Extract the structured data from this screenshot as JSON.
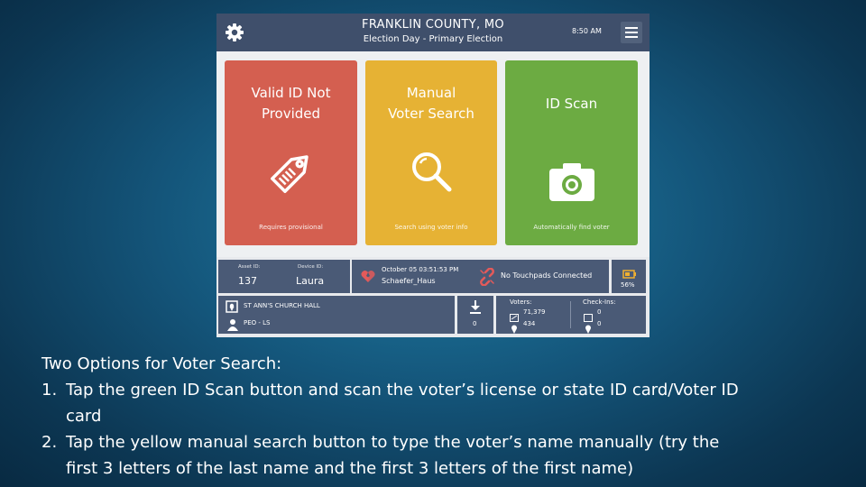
{
  "header": {
    "county": "FRANKLIN COUNTY, MO",
    "subtitle": "Election Day - Primary Election",
    "time": "8:50 AM"
  },
  "tiles": [
    {
      "title_line1": "Valid ID Not",
      "title_line2": "Provided",
      "caption": "Requires provisional",
      "icon": "tag-icon",
      "color": "#d45f50"
    },
    {
      "title_line1": "Manual",
      "title_line2": "Voter Search",
      "caption": "Search using voter info",
      "icon": "search-icon",
      "color": "#e6b234"
    },
    {
      "title_line1": "ID Scan",
      "title_line2": "",
      "caption": "Automatically find voter",
      "icon": "camera-icon",
      "color": "#6cab42"
    }
  ],
  "status": {
    "asset_label": "Asset ID:",
    "asset_id": "137",
    "device_label": "Device ID:",
    "device_id": "Laura",
    "news_date": "October 05  03:51:53 PM",
    "news_user": "Schaefer_Haus",
    "touchpad": "No Touchpads Connected",
    "battery": "56%",
    "location": "ST ANN'S CHURCH HALL",
    "role": "PEO - LS",
    "download_count": "0",
    "voters_label": "Voters:",
    "voters_count": "71,379",
    "voters_local": "434",
    "checkins_label": "Check-Ins:",
    "checkins_count": "0",
    "checkins_local": "0"
  },
  "instructions": {
    "heading": "Two Options for Voter Search:",
    "items": [
      {
        "num": "1.",
        "line1": "Tap the green ID Scan button and scan the voter’s license or state ID card/Voter ID",
        "line2": "card"
      },
      {
        "num": "2.",
        "line1": "Tap the yellow manual search button to type the voter’s name manually (try the",
        "line2": "first 3 letters of the last name and the first 3 letters of the first name)"
      }
    ]
  }
}
